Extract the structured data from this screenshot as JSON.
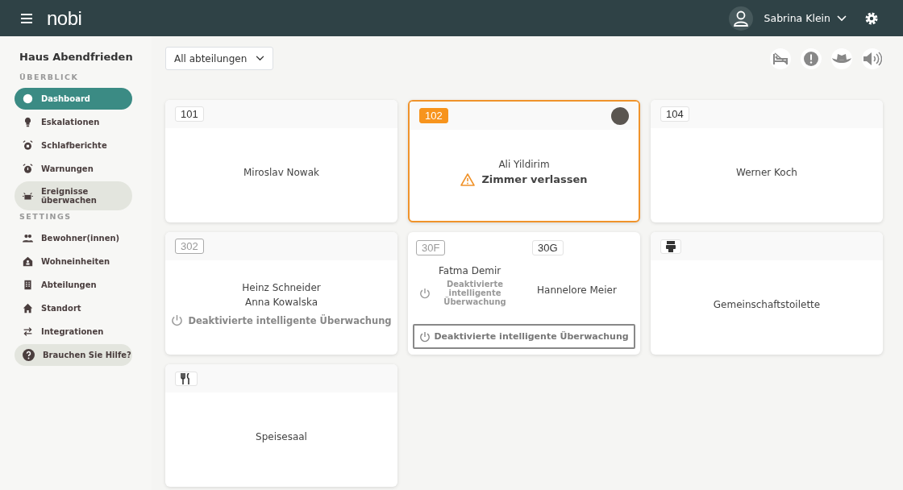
{
  "topbar": {
    "logo": "nobi",
    "user": "Sabrina Klein"
  },
  "sidebar": {
    "title": "Haus Abendfrieden",
    "sections": [
      {
        "heading": "ÜBERBLICK",
        "items": [
          {
            "label": "Dashboard",
            "selected": true,
            "hovered": false
          },
          {
            "label": "Eskalationen",
            "selected": false,
            "hovered": false
          },
          {
            "label": "Schlafberichte",
            "selected": false,
            "hovered": false
          },
          {
            "label": "Warnungen",
            "selected": false,
            "hovered": false
          },
          {
            "label": "Ereignisse überwachen",
            "selected": false,
            "hovered": true
          }
        ]
      },
      {
        "heading": "SETTINGS",
        "items": [
          {
            "label": "Bewohner(innen)",
            "selected": false,
            "hovered": false
          },
          {
            "label": "Wohneinheiten",
            "selected": false,
            "hovered": false
          },
          {
            "label": "Abteilungen",
            "selected": false,
            "hovered": false
          },
          {
            "label": "Standort",
            "selected": false,
            "hovered": false
          },
          {
            "label": "Integrationen",
            "selected": false,
            "hovered": false
          }
        ]
      }
    ],
    "help": "Brauchen Sie Hilfe?"
  },
  "filter": {
    "value": "All abteilungen"
  },
  "cards": [
    {
      "kind": "room",
      "room": "101",
      "residents": [
        "Miroslav Nowak"
      ]
    },
    {
      "kind": "alert",
      "room": "102",
      "residents": [
        "Ali Yildirim"
      ],
      "alert": "Zimmer verlassen"
    },
    {
      "kind": "room",
      "room": "104",
      "residents": [
        "Werner Koch"
      ]
    },
    {
      "kind": "deactivated",
      "room": "302",
      "residents": [
        "Heinz Schneider",
        "Anna Kowalska"
      ],
      "status": "Deaktivierte intelligente Überwachung"
    },
    {
      "kind": "split",
      "rooms": [
        {
          "room": "30F",
          "resident": "Fatma Demir",
          "status": "Deaktivierte intelligente Überwachung"
        },
        {
          "room": "30G",
          "resident": "Hannelore Meier"
        }
      ],
      "button": "Deaktivierte intelligente Überwachung"
    },
    {
      "kind": "toilet",
      "name": "Gemeinschaftstoilette"
    },
    {
      "kind": "dining",
      "name": "Speisesaal"
    }
  ]
}
